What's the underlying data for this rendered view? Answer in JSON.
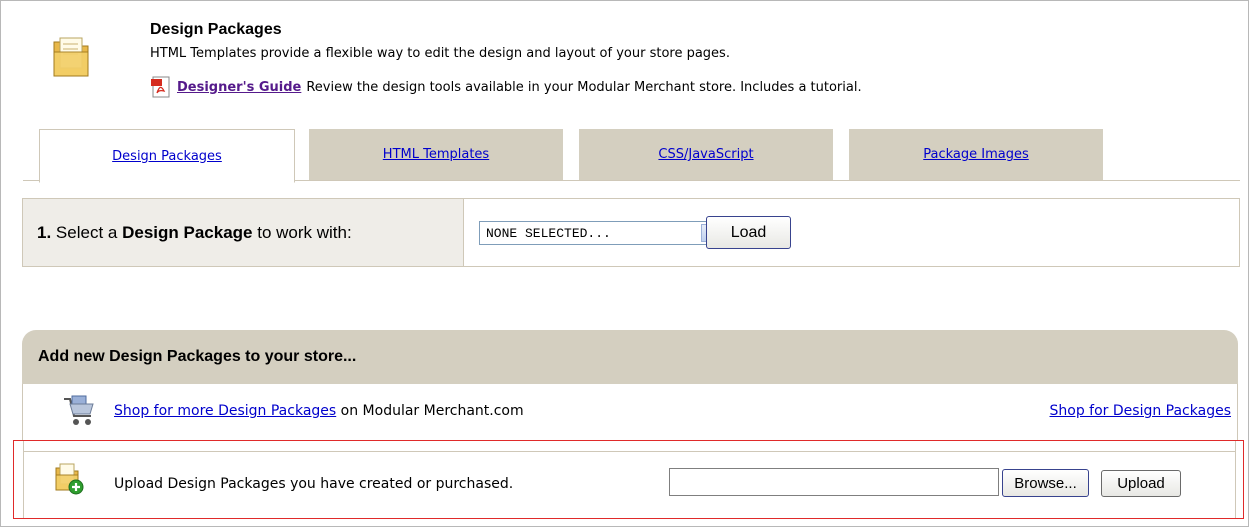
{
  "header": {
    "title": "Design Packages",
    "description": "HTML Templates provide a flexible way to edit the design and layout of your store pages.",
    "guide_link": "Designer's Guide",
    "guide_text": "Review the design tools available in your Modular Merchant store. Includes a tutorial."
  },
  "tabs": [
    {
      "label": "Design Packages",
      "active": true
    },
    {
      "label": "HTML Templates",
      "active": false
    },
    {
      "label": "CSS/JavaScript",
      "active": false
    },
    {
      "label": "Package Images",
      "active": false
    }
  ],
  "select_section": {
    "step": "1.",
    "label_pre": "Select a",
    "label_bold": "Design Package",
    "label_post": "to work with:",
    "dropdown_value": "NONE SELECTED...",
    "load_button": "Load"
  },
  "add_section": {
    "heading": "Add new Design Packages to your store...",
    "shop_link": "Shop for more Design Packages",
    "shop_suffix": "on Modular Merchant.com",
    "shop_right_link": "Shop for Design Packages",
    "upload_text": "Upload Design Packages you have created or purchased.",
    "file_value": "",
    "browse_button": "Browse...",
    "upload_button": "Upload"
  },
  "colors": {
    "tab_bg": "#d4cfc0",
    "label_bg": "#efede8",
    "link": "#0000cc",
    "visited_link": "#551a8b",
    "highlight_border": "#e02a2a"
  }
}
